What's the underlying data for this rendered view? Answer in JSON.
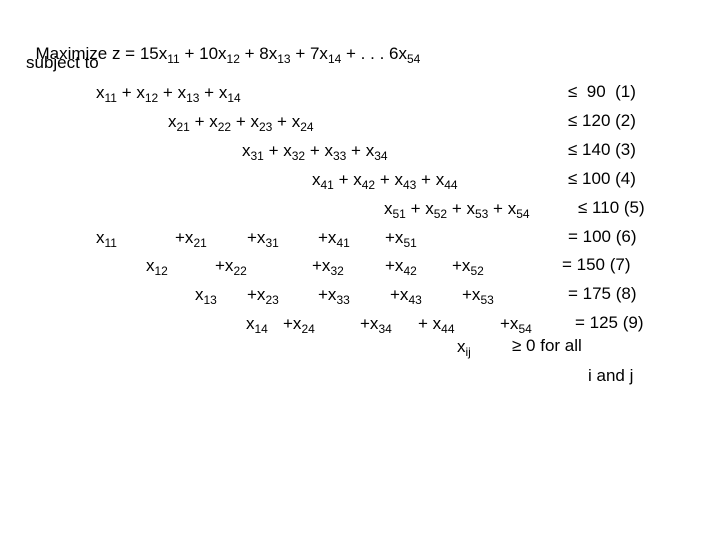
{
  "objective": {
    "prefix": "Maximize z = ",
    "terms": [
      {
        "coef": "15x",
        "sub": "11",
        "sep": " + "
      },
      {
        "coef": "10x",
        "sub": "12",
        "sep": " + "
      },
      {
        "coef": "8x",
        "sub": "13",
        "sep": " + "
      },
      {
        "coef": "7x",
        "sub": "14",
        "sep": " + . . . "
      },
      {
        "coef": "6x",
        "sub": "54",
        "sep": ""
      }
    ]
  },
  "subject_to": "subject to",
  "supply_constraints": [
    {
      "subs": [
        "11",
        "12",
        "13",
        "14"
      ],
      "rhs": "≤  90  (1)"
    },
    {
      "subs": [
        "21",
        "22",
        "23",
        "24"
      ],
      "rhs": "≤ 120 (2)"
    },
    {
      "subs": [
        "31",
        "32",
        "33",
        "34"
      ],
      "rhs": "≤ 140 (3)"
    },
    {
      "subs": [
        "41",
        "42",
        "43",
        "44"
      ],
      "rhs": "≤ 100 (4)"
    },
    {
      "subs": [
        "51",
        "52",
        "53",
        "54"
      ],
      "rhs": "≤ 110 (5)"
    }
  ],
  "demand_constraints": [
    {
      "terms": [
        {
          "p": "x",
          "s": "11"
        },
        {
          "p": "+x",
          "s": "21"
        },
        {
          "p": "+x",
          "s": "31"
        },
        {
          "p": "+x",
          "s": "41"
        },
        {
          "p": "+x",
          "s": "51"
        }
      ],
      "rhs": "= 100 (6)"
    },
    {
      "terms": [
        {
          "p": "x",
          "s": "12"
        },
        {
          "p": "+x",
          "s": "22"
        },
        {
          "p": "+x",
          "s": "32"
        },
        {
          "p": "+x",
          "s": "42"
        },
        {
          "p": "+x",
          "s": "52"
        }
      ],
      "rhs": "= 150 (7)"
    },
    {
      "terms": [
        {
          "p": "x",
          "s": "13"
        },
        {
          "p": "+x",
          "s": "23"
        },
        {
          "p": "+x",
          "s": "33"
        },
        {
          "p": "+x",
          "s": "43"
        },
        {
          "p": "+x",
          "s": "53"
        }
      ],
      "rhs": "= 175 (8)"
    },
    {
      "terms": [
        {
          "p": "x",
          "s": "14"
        },
        {
          "p": "+x",
          "s": "24"
        },
        {
          "p": "+x",
          "s": "34"
        },
        {
          "p": "+ x",
          "s": "44"
        },
        {
          "p": "+x",
          "s": "54"
        }
      ],
      "rhs": "= 125 (9)"
    }
  ],
  "nonnegativity": {
    "var": "x",
    "sub": "ij",
    "text": "≥ 0 for all",
    "text2": "i and j"
  }
}
